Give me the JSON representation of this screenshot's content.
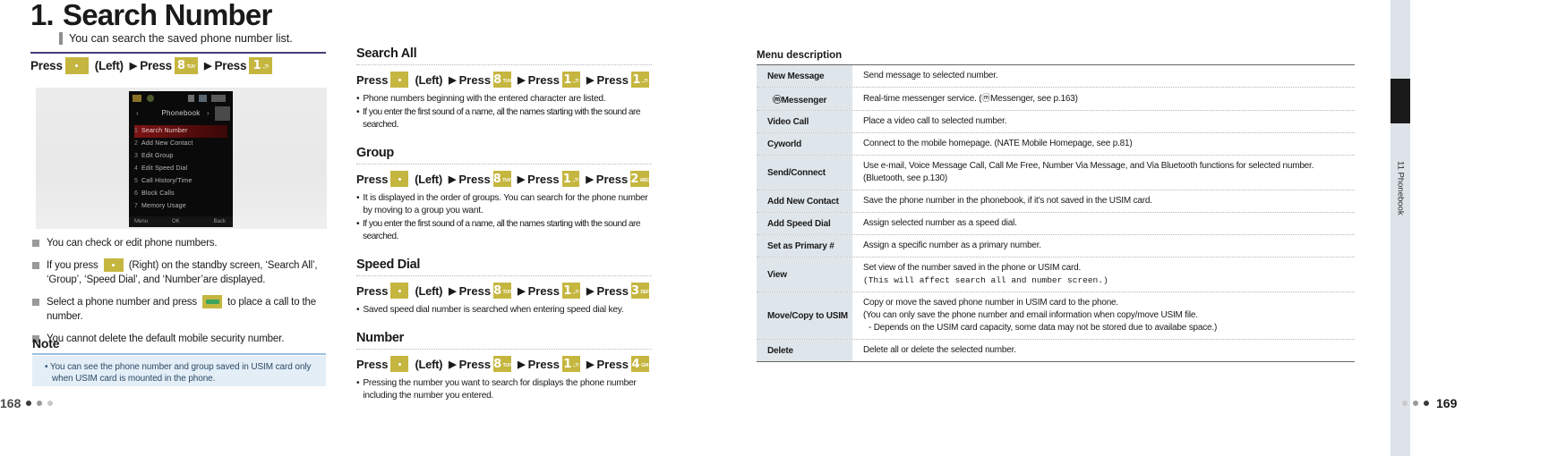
{
  "left": {
    "title_number": "1.",
    "title": "Search Number",
    "subtitle": "You can search the saved phone number list.",
    "press_line": {
      "press1": "Press",
      "key1": {
        "main": "",
        "sub": "",
        "type": "nav"
      },
      "left_label": "(Left)",
      "press2": "Press",
      "key2": {
        "main": "8",
        "sub": "TUV",
        "type": "num"
      },
      "press3": "Press",
      "key3": {
        "main": "1",
        "sub": ".,?!",
        "type": "num"
      }
    },
    "phone_screen": {
      "title": "Phonebook",
      "items": [
        {
          "index": "1",
          "label": "Search Number",
          "selected": true
        },
        {
          "index": "2",
          "label": "Add New Contact",
          "selected": false
        },
        {
          "index": "3",
          "label": "Edit Group",
          "selected": false
        },
        {
          "index": "4",
          "label": "Edit Speed Dial",
          "selected": false
        },
        {
          "index": "5",
          "label": "Call History/Time",
          "selected": false
        },
        {
          "index": "6",
          "label": "Block Calls",
          "selected": false
        },
        {
          "index": "7",
          "label": "Memory Usage",
          "selected": false
        }
      ],
      "soft_left": "Menu",
      "soft_center": "OK",
      "soft_right": "Back"
    },
    "bullets": [
      {
        "pre": "You can check or edit phone numbers.",
        "key": null,
        "post": ""
      },
      {
        "pre": "If you press ",
        "key": {
          "main": "",
          "sub": "",
          "type": "nav"
        },
        "post": " (Right) on the standby screen,  ‘Search All’, ‘Group’, ‘Speed Dial’, and ‘Number’are displayed."
      },
      {
        "pre": "Select a phone number and press ",
        "key": {
          "main": "",
          "sub": "",
          "type": "call"
        },
        "post": " to place a call to the number."
      },
      {
        "pre": "You cannot delete the default mobile security number.",
        "key": null,
        "post": ""
      }
    ],
    "note": {
      "heading": "Note",
      "line1": "• You can see the phone number and group saved in USIM card only",
      "line2": "when USIM card is mounted in the phone."
    },
    "page_number": "168"
  },
  "middle": {
    "sections": [
      {
        "heading": "Search All",
        "press": {
          "p1": "Press",
          "k1": {
            "main": "",
            "sub": "",
            "type": "nav"
          },
          "left": "(Left)",
          "p2": "Press",
          "k2": {
            "main": "8",
            "sub": "TUV",
            "type": "num"
          },
          "p3": "Press",
          "k3": {
            "main": "1",
            "sub": ".,?!",
            "type": "num"
          },
          "p4": "Press",
          "k4": {
            "main": "1",
            "sub": ".,?!",
            "type": "num"
          }
        },
        "notes": [
          "Phone numbers beginning with the entered character are listed.",
          "If you enter the first sound of a name, all the names starting with the sound are searched."
        ]
      },
      {
        "heading": "Group",
        "press": {
          "p1": "Press",
          "k1": {
            "main": "",
            "sub": "",
            "type": "nav"
          },
          "left": "(Left)",
          "p2": "Press",
          "k2": {
            "main": "8",
            "sub": "TUV",
            "type": "num"
          },
          "p3": "Press",
          "k3": {
            "main": "1",
            "sub": ".,?!",
            "type": "num"
          },
          "p4": "Press",
          "k4": {
            "main": "2",
            "sub": "ABC",
            "type": "num"
          }
        },
        "notes": [
          "It is displayed in the order of groups. You can search for the phone number by moving to a group you want.",
          "If you enter the first sound of a name, all the names starting with the sound are searched."
        ]
      },
      {
        "heading": "Speed Dial",
        "press": {
          "p1": "Press",
          "k1": {
            "main": "",
            "sub": "",
            "type": "nav"
          },
          "left": "(Left)",
          "p2": "Press",
          "k2": {
            "main": "8",
            "sub": "TUV",
            "type": "num"
          },
          "p3": "Press",
          "k3": {
            "main": "1",
            "sub": ".,?!",
            "type": "num"
          },
          "p4": "Press",
          "k4": {
            "main": "3",
            "sub": "DEF",
            "type": "num"
          }
        },
        "notes": [
          "Saved speed dial number is searched when entering speed dial key."
        ]
      },
      {
        "heading": "Number",
        "press": {
          "p1": "Press",
          "k1": {
            "main": "",
            "sub": "",
            "type": "nav"
          },
          "left": "(Left)",
          "p2": "Press",
          "k2": {
            "main": "8",
            "sub": "TUV",
            "type": "num"
          },
          "p3": "Press",
          "k3": {
            "main": "1",
            "sub": ".,?!",
            "type": "num"
          },
          "p4": "Press",
          "k4": {
            "main": "4",
            "sub": "GHI",
            "type": "num"
          }
        },
        "notes": [
          "Pressing the number you want to search for displays the phone number including the number you entered."
        ]
      }
    ]
  },
  "right": {
    "table_heading": "Menu description",
    "rows": [
      {
        "label": "New Message",
        "lines": [
          "Send message to selected number."
        ]
      },
      {
        "label": "ⓜMessenger",
        "lines": [
          "Real-time messenger service.  (ⓜMessenger, see p.163)"
        ]
      },
      {
        "label": "Video Call",
        "lines": [
          "Place a video call to selected number."
        ]
      },
      {
        "label": "Cyworld",
        "lines": [
          "Connect to the mobile homepage. (NATE Mobile Homepage, see p.81)"
        ]
      },
      {
        "label": "Send/Connect",
        "lines": [
          "Use e-mail, Voice Message Call, Call Me Free, Number Via Message, and Via Bluetooth functions for selected number. (Bluetooth, see p.130)"
        ]
      },
      {
        "label": "Add New Contact",
        "lines": [
          "Save the phone number in the phonebook, if it’s not saved in the USIM card."
        ]
      },
      {
        "label": "Add Speed Dial",
        "lines": [
          "Assign selected number as a speed dial."
        ]
      },
      {
        "label": "Set as Primary #",
        "lines": [
          "Assign a specific number as a primary number."
        ]
      },
      {
        "label": "View",
        "lines": [
          "Set view of the number saved in the phone or USIM card.",
          "(This will affect search all and number screen.)"
        ],
        "mono_lines": [
          1
        ]
      },
      {
        "label": "Move/Copy to USIM",
        "lines": [
          "Copy or move the saved phone number in USIM card to the phone.",
          "(You can only save the phone number and email information when copy/move USIM file.",
          "- Depends on the USIM card capacity, some data may not be stored due to availabe space.)"
        ]
      },
      {
        "label": "Delete",
        "lines": [
          "Delete all or delete the selected number."
        ]
      }
    ],
    "side_tab_label": "11 Phonebook",
    "page_number": "169"
  },
  "colors": {
    "key_bg": "#c5b640",
    "call_green": "#3ea35c",
    "table_label_bg": "#dfe6eb",
    "note_bg": "#e3eef7",
    "note_rule": "#9cc0e0",
    "purple_rule": "#4b3a7a"
  }
}
